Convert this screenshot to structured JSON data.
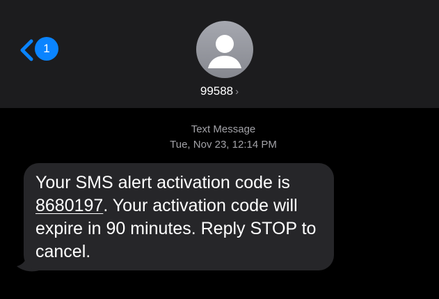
{
  "header": {
    "back_badge_count": "1",
    "contact_name": "99588",
    "contact_chevron": "›"
  },
  "icons": {
    "back": "chevron-left-icon",
    "avatar": "person-silhouette-icon",
    "disclosure": "chevron-right-icon"
  },
  "conversation": {
    "message_type": "Text Message",
    "timestamp": "Tue, Nov 23, 12:14 PM",
    "message": {
      "text_before_code": "Your SMS alert activation code is ",
      "code": "8680197",
      "text_after_code": ". Your activation code will expire in 90 minutes. Reply STOP to cancel."
    }
  },
  "colors": {
    "accent_blue": "#0a84ff",
    "header_background": "#1c1c1e",
    "bubble_background": "#262629",
    "screen_background": "#000000",
    "secondary_text": "#a2a2a7"
  }
}
